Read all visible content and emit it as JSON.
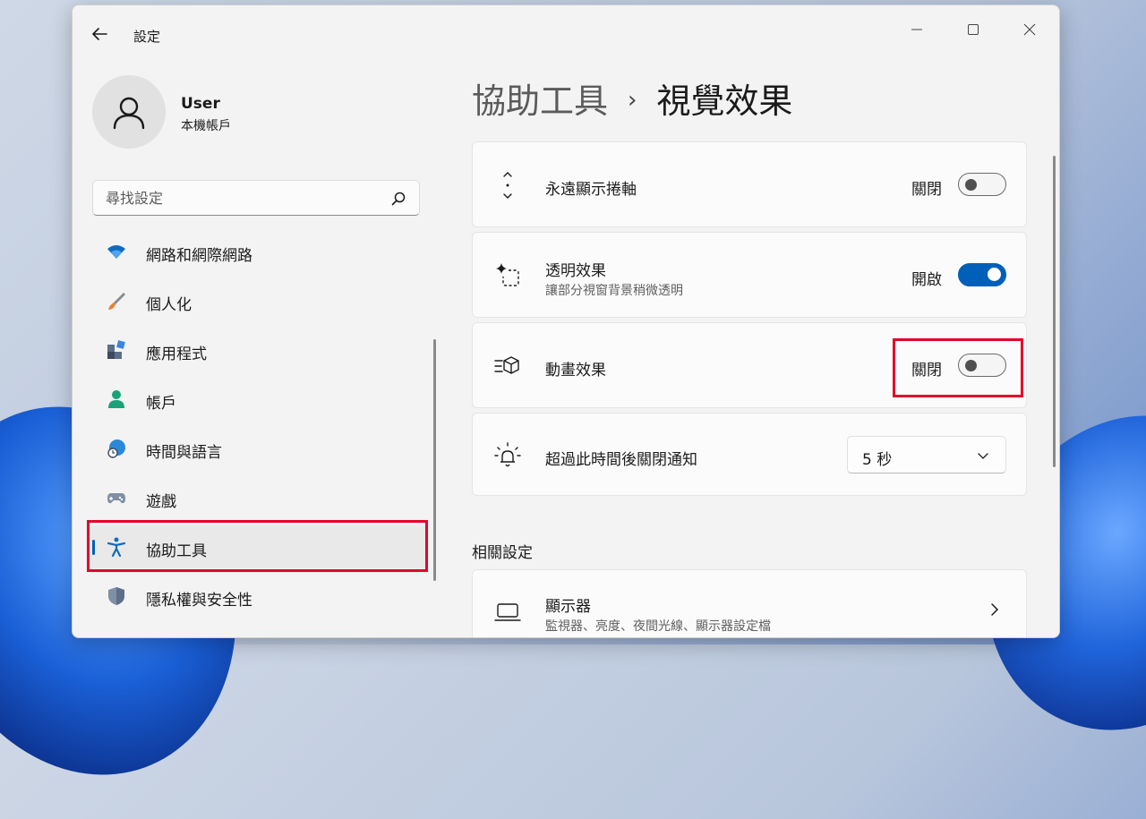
{
  "app": {
    "title": "設定"
  },
  "user": {
    "name": "User",
    "account_type": "本機帳戶"
  },
  "search": {
    "placeholder": "尋找設定"
  },
  "sidebar": {
    "items": [
      {
        "label": "網路和網際網路",
        "icon": "wifi-icon"
      },
      {
        "label": "個人化",
        "icon": "brush-icon"
      },
      {
        "label": "應用程式",
        "icon": "apps-icon"
      },
      {
        "label": "帳戶",
        "icon": "account-icon"
      },
      {
        "label": "時間與語言",
        "icon": "globe-clock-icon"
      },
      {
        "label": "遊戲",
        "icon": "gamepad-icon"
      },
      {
        "label": "協助工具",
        "icon": "accessibility-icon",
        "active": true
      },
      {
        "label": "隱私權與安全性",
        "icon": "shield-icon"
      }
    ]
  },
  "breadcrumb": {
    "parent": "協助工具",
    "separator": "›",
    "current": "視覺效果"
  },
  "settings": {
    "scrollbars": {
      "title": "永遠顯示捲軸",
      "state": "關閉",
      "on": false,
      "icon": "scroll-arrows-icon"
    },
    "transparency": {
      "title": "透明效果",
      "subtitle": "讓部分視窗背景稍微透明",
      "state": "開啟",
      "on": true,
      "icon": "transparency-sparkle-icon"
    },
    "animation": {
      "title": "動畫效果",
      "state": "關閉",
      "on": false,
      "icon": "animation-cube-icon"
    },
    "notifications": {
      "title": "超過此時間後關閉通知",
      "value": "5 秒",
      "icon": "bell-icon"
    }
  },
  "related": {
    "title": "相關設定",
    "display": {
      "title": "顯示器",
      "subtitle": "監視器、亮度、夜間光線、顯示器設定檔",
      "icon": "laptop-icon"
    }
  },
  "colors": {
    "accent": "#005fb8",
    "highlight": "#e4002b"
  }
}
